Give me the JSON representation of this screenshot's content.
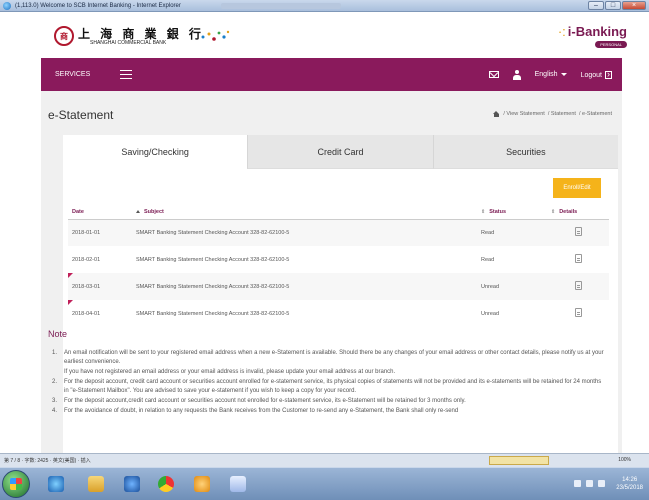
{
  "window": {
    "title": "(1,113.0) Welcome to SCB Internet Banking - Internet Explorer",
    "min_label": "–",
    "max_label": "□",
    "close_label": "×"
  },
  "bank": {
    "name_cn": "上 海 商 業 銀 行",
    "name_en": "SHANGHAI COMMERCIAL BANK",
    "seal_text": "商",
    "product": "i-Banking",
    "product_prefix": "·:",
    "personal": "PERSONAL"
  },
  "nav": {
    "services": "SERVICES",
    "language": "English",
    "logout": "Logout"
  },
  "page": {
    "title": "e-Statement",
    "breadcrumb": [
      "/ View Statement",
      "/ Statement",
      "/ e-Statement"
    ]
  },
  "tabs": [
    {
      "label": "Saving/Checking",
      "active": true
    },
    {
      "label": "Credit Card",
      "active": false
    },
    {
      "label": "Securities",
      "active": false
    }
  ],
  "enroll_button": "Enroll/Edit",
  "table": {
    "headers": {
      "date": "Date",
      "subject": "Subject",
      "status": "Status",
      "details": "Details"
    },
    "rows": [
      {
        "date": "2018-01-01",
        "subject": "SMART Banking Statement Checking Account 328-82-62100-5",
        "status": "Read",
        "flag": false
      },
      {
        "date": "2018-02-01",
        "subject": "SMART Banking Statement Checking Account 328-82-62100-5",
        "status": "Read",
        "flag": false
      },
      {
        "date": "2018-03-01",
        "subject": "SMART Banking Statement Checking Account 328-82-62100-5",
        "status": "Unread",
        "flag": true
      },
      {
        "date": "2018-04-01",
        "subject": "SMART Banking Statement Checking Account 328-82-62100-5",
        "status": "Unread",
        "flag": true
      }
    ]
  },
  "note": {
    "title": "Note",
    "items": [
      {
        "num": "1.",
        "text": "An email notification will be sent to your registered email address when a new e-Statement is available. Should there be any changes of your email address or other contact details, please notify us at your earliest convenience."
      },
      {
        "num": "",
        "text": "If you have not registered an email address or your email address is invalid, please update your email address at our branch."
      },
      {
        "num": "2.",
        "text": "For the deposit account, credit card account or securities account enrolled for e-statement service, its physical copies of statements will not be provided and its e-statements will be retained for 24 months in \"e-Statement Mailbox\". You are advised to save your e-statement if you wish to keep a copy for your record."
      },
      {
        "num": "3.",
        "text": "For the deposit account,credit card account or securities account not enrolled for e-statement service, its e-Statement will be retained for 3 months only."
      },
      {
        "num": "4.",
        "text": "For the avoidance of doubt, in relation to any requests the Bank receives from the Customer to re-send any e-Statement, the Bank shall only re-send"
      }
    ]
  },
  "statusbar": {
    "left": "第 7 / 8 · 字数: 2425 · 英文(美国) · 插入",
    "zoom": "100%"
  },
  "taskbar": {
    "time": "14:26",
    "date": "23/5/2018"
  },
  "colors": {
    "brand": "#8a1a5c",
    "accent": "#f5b31a",
    "flag": "#c0205a"
  }
}
